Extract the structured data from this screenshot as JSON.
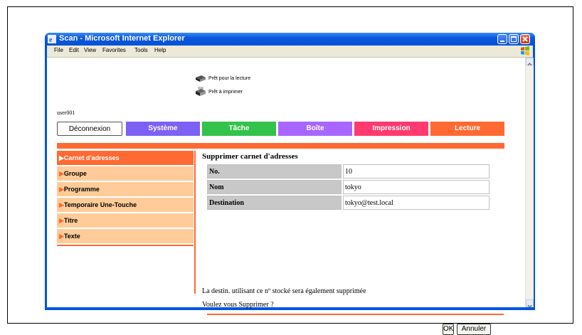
{
  "window": {
    "title": "Scan - Microsoft Internet Explorer",
    "menu": [
      "File",
      "Edit",
      "View",
      "Favorites",
      "Tools",
      "Help"
    ]
  },
  "status": {
    "scan_ready": "Prêt pour la lecture",
    "print_ready": "Prêt à imprimer"
  },
  "user": "user001",
  "tabs": [
    {
      "label": "Déconnexion",
      "color": "#ffffff"
    },
    {
      "label": "Système",
      "color": "#7d60f4"
    },
    {
      "label": "Tâche",
      "color": "#33c24a"
    },
    {
      "label": "Boîte",
      "color": "#a866ff"
    },
    {
      "label": "Impression",
      "color": "#ff3a6e"
    },
    {
      "label": "Lecture",
      "color": "#ff6a32"
    }
  ],
  "sidebar": {
    "items": [
      {
        "label": "Carnet d'adresses",
        "active": true
      },
      {
        "label": "Groupe"
      },
      {
        "label": "Programme"
      },
      {
        "label": "Temporaire Une-Touche"
      },
      {
        "label": "Titre"
      },
      {
        "label": "Texte"
      }
    ]
  },
  "main": {
    "heading": "Supprimer carnet d'adresses",
    "rows": [
      {
        "label": "No.",
        "value": "10"
      },
      {
        "label": "Nom",
        "value": "tokyo"
      },
      {
        "label": "Destination",
        "value": "tokyo@test.local"
      }
    ],
    "message1": "La destin. utilisant ce nº stocké sera également supprimée",
    "message2": "Voulez vous Supprimer ?",
    "ok_label": "OK",
    "cancel_label": "Annuler"
  },
  "colors": {
    "accent": "#ff6a32",
    "sidebar_bg": "#ffcc99",
    "xp_blue": "#0054e3"
  },
  "icons": [
    "ie-icon",
    "minimize-icon",
    "maximize-icon",
    "close-icon",
    "windows-logo-icon",
    "scanner-icon",
    "printer-icon"
  ]
}
